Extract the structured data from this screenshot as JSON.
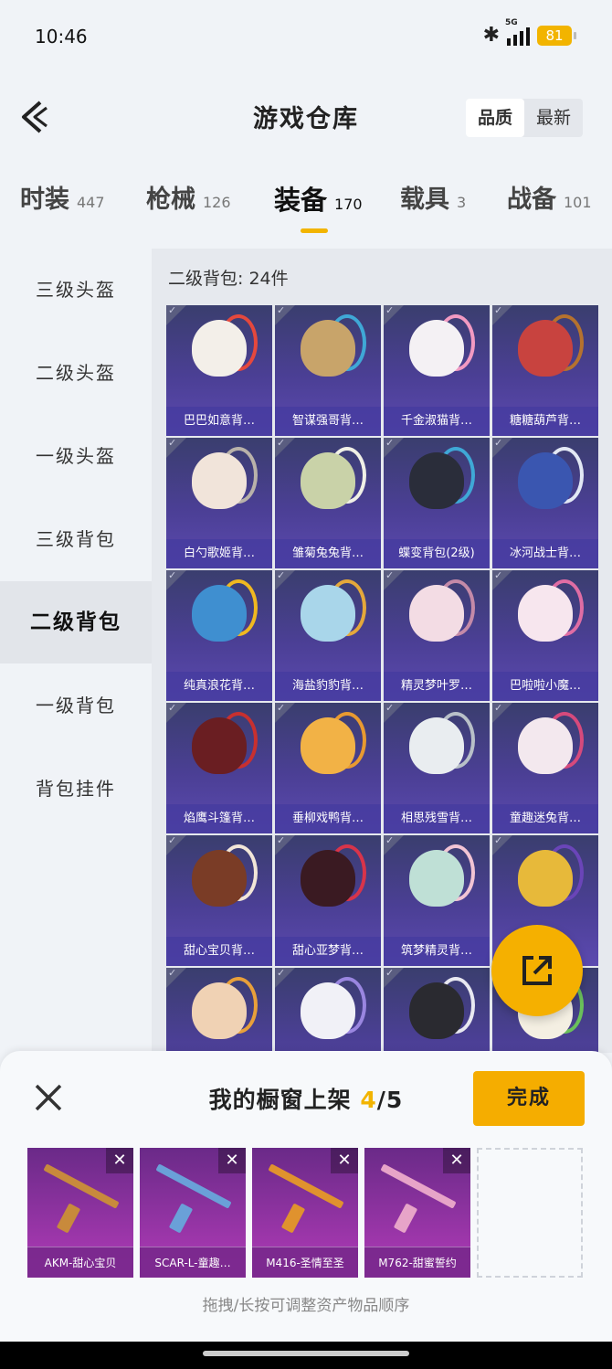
{
  "status_bar": {
    "time": "10:46",
    "network": "5G",
    "battery": "81"
  },
  "header": {
    "title": "游戏仓库",
    "sort_options": [
      "品质",
      "最新"
    ],
    "active_sort": "品质"
  },
  "tabs": [
    {
      "label": "时装",
      "count": "447"
    },
    {
      "label": "枪械",
      "count": "126"
    },
    {
      "label": "装备",
      "count": "170",
      "active": true
    },
    {
      "label": "载具",
      "count": "3"
    },
    {
      "label": "战备",
      "count": "101"
    }
  ],
  "sidebar": {
    "items": [
      "三级头盔",
      "二级头盔",
      "一级头盔",
      "三级背包",
      "二级背包",
      "一级背包",
      "背包挂件"
    ],
    "active": "二级背包"
  },
  "content": {
    "section_title": "二级背包: 24件",
    "items": [
      {
        "name": "巴巴如意背…",
        "color": "#f3efe9",
        "accent": "#e5483d"
      },
      {
        "name": "智谋强哥背…",
        "color": "#c8a46a",
        "accent": "#3fa8d6"
      },
      {
        "name": "千金淑猫背…",
        "color": "#f4f1f4",
        "accent": "#f29ac2"
      },
      {
        "name": "糖糖葫芦背…",
        "color": "#c8433f",
        "accent": "#b5722e"
      },
      {
        "name": "白勺歌姬背…",
        "color": "#f1e4da",
        "accent": "#b9b2aa"
      },
      {
        "name": "雏菊兔兔背…",
        "color": "#c9d2a8",
        "accent": "#f0f0e6"
      },
      {
        "name": "蝶变背包(2级)",
        "color": "#2a2d3a",
        "accent": "#3fa8d6"
      },
      {
        "name": "冰河战士背…",
        "color": "#3a56b0",
        "accent": "#e2e8f4"
      },
      {
        "name": "纯真浪花背…",
        "color": "#3f8fd0",
        "accent": "#f0b820"
      },
      {
        "name": "海盐豹豹背…",
        "color": "#a9d6ea",
        "accent": "#e5a83a"
      },
      {
        "name": "精灵梦叶罗…",
        "color": "#f3dce4",
        "accent": "#c48aa8"
      },
      {
        "name": "巴啦啦小魔…",
        "color": "#f7e6ee",
        "accent": "#e06da4"
      },
      {
        "name": "焰鹰斗篷背…",
        "color": "#6a1e22",
        "accent": "#c8302f"
      },
      {
        "name": "垂柳戏鸭背…",
        "color": "#f2b246",
        "accent": "#e89a30"
      },
      {
        "name": "相思残雪背…",
        "color": "#e9edf0",
        "accent": "#b8c0c8"
      },
      {
        "name": "童趣迷兔背…",
        "color": "#f3e8ee",
        "accent": "#d64a7c"
      },
      {
        "name": "甜心宝贝背…",
        "color": "#7a3c26",
        "accent": "#f2e6d8"
      },
      {
        "name": "甜心亚梦背…",
        "color": "#3a1a22",
        "accent": "#d8344a"
      },
      {
        "name": "筑梦精灵背…",
        "color": "#bfe0d6",
        "accent": "#f2c4d4"
      },
      {
        "name": "",
        "color": "#e7b93a",
        "accent": "#6a45b8"
      },
      {
        "name": "",
        "color": "#f0d2b4",
        "accent": "#e8a03a"
      },
      {
        "name": "",
        "color": "#f1f1f7",
        "accent": "#9a86e0"
      },
      {
        "name": "",
        "color": "#2a2a30",
        "accent": "#e8e8f0"
      },
      {
        "name": "",
        "color": "#f4efe2",
        "accent": "#6ac05a"
      }
    ]
  },
  "bottom_sheet": {
    "title": "我的橱窗上架",
    "count_current": "4",
    "count_total": "/5",
    "done_label": "完成",
    "hint": "拖拽/长按可调整资产物品顺序",
    "slots": [
      {
        "name": "AKM-甜心宝贝",
        "gun_color": "#c88a3c"
      },
      {
        "name": "SCAR-L-童趣…",
        "gun_color": "#6aa0d8"
      },
      {
        "name": "M416-圣情至圣",
        "gun_color": "#e0922e"
      },
      {
        "name": "M762-甜蜜誓约",
        "gun_color": "#e7a4c8"
      }
    ]
  }
}
